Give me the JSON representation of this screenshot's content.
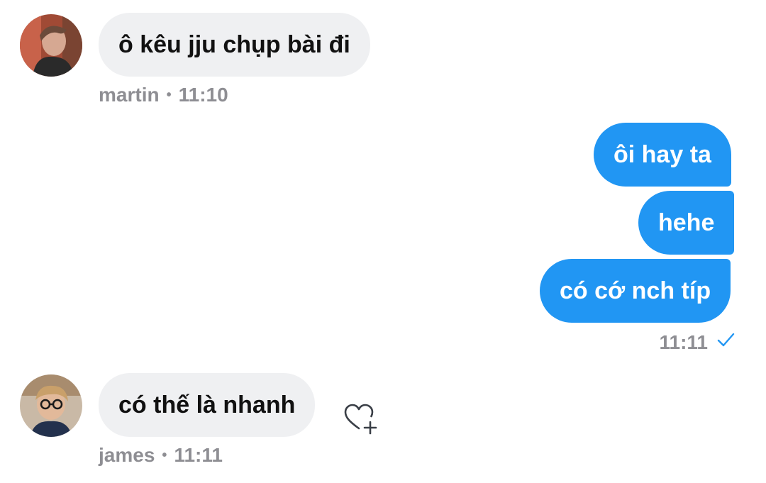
{
  "messages": [
    {
      "sender": "martin",
      "time": "11:10",
      "text": "ô kêu jju chụp bài đi"
    },
    {
      "sender": "me",
      "text": "ôi hay ta"
    },
    {
      "sender": "me",
      "text": "hehe"
    },
    {
      "sender": "me",
      "text": "có cớ nch típ",
      "time": "11:11",
      "status_icon": "check-icon"
    },
    {
      "sender": "james",
      "time": "11:11",
      "text": "có thế là nhanh"
    }
  ],
  "dot_separator": "•",
  "colors": {
    "outgoing_bubble": "#2196f3",
    "incoming_bubble": "#eff0f2",
    "meta_text": "#8e8e93",
    "check": "#2196f3"
  },
  "icons": {
    "reaction": "heart-plus-icon",
    "read_status": "check-icon"
  }
}
